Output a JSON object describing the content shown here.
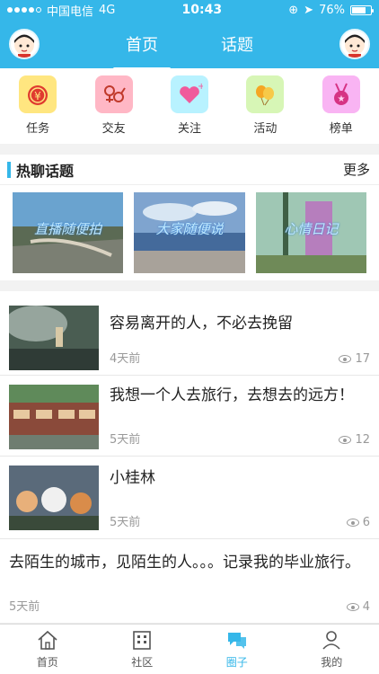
{
  "status_bar": {
    "carrier": "中国电信",
    "network": "4G",
    "time": "10:43",
    "battery": "76%"
  },
  "header": {
    "tabs": [
      {
        "label": "首页",
        "active": true
      },
      {
        "label": "话题",
        "active": false
      }
    ],
    "accent_color": "#35b7e9"
  },
  "quick_actions": [
    {
      "label": "任务",
      "icon": "money-bag-icon",
      "bg": "#ffe680"
    },
    {
      "label": "交友",
      "icon": "gender-icon",
      "bg": "#ffb7c5"
    },
    {
      "label": "关注",
      "icon": "heart-icon",
      "bg": "#b8f2ff"
    },
    {
      "label": "活动",
      "icon": "balloon-icon",
      "bg": "#d7f6b6"
    },
    {
      "label": "榜单",
      "icon": "medal-icon",
      "bg": "#f9b4f3"
    }
  ],
  "hot_topics": {
    "title": "热聊话题",
    "more_label": "更多",
    "items": [
      {
        "caption": "直播随便拍"
      },
      {
        "caption": "大家随便说"
      },
      {
        "caption": "心情日记"
      }
    ]
  },
  "feed": [
    {
      "title": "容易离开的人，不必去挽留",
      "time": "4天前",
      "views": "17"
    },
    {
      "title": "我想一个人去旅行，去想去的远方！",
      "time": "5天前",
      "views": "12"
    },
    {
      "title": "小桂林",
      "time": "5天前",
      "views": "6"
    },
    {
      "title": "去陌生的城市，见陌生的人。。。记录我的毕业旅行。",
      "time": "5天前",
      "views": "4"
    }
  ],
  "bottom_nav": [
    {
      "label": "首页",
      "icon": "home-icon",
      "active": false
    },
    {
      "label": "社区",
      "icon": "building-icon",
      "active": false
    },
    {
      "label": "圈子",
      "icon": "chat-bubbles-icon",
      "active": true
    },
    {
      "label": "我的",
      "icon": "person-icon",
      "active": false
    }
  ]
}
